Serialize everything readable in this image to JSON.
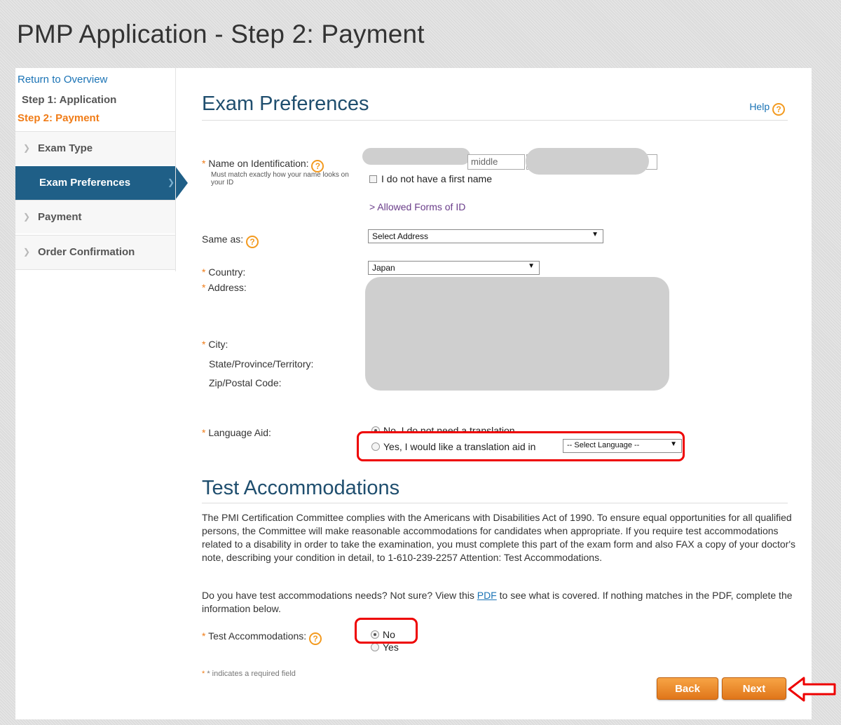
{
  "page": {
    "title": "PMP Application - Step 2: Payment"
  },
  "sidebar": {
    "return_link": "Return to Overview",
    "step1": "Step 1: Application",
    "step2": "Step 2: Payment",
    "items": [
      {
        "label": "Exam Type"
      },
      {
        "label": "Exam Preferences",
        "active": true
      },
      {
        "label": "Payment"
      },
      {
        "label": "Order Confirmation"
      }
    ]
  },
  "exam_preferences": {
    "title": "Exam Preferences",
    "help": "Help",
    "name_label": "Name on Identification:",
    "name_note": "Must match exactly how your name looks on your ID",
    "middle_placeholder": "middle",
    "no_first_name": "I do not have a first name",
    "allowed_forms": "> Allowed Forms of ID",
    "same_as_label": "Same as:",
    "same_as_value": "Select Address",
    "country_label": "Country:",
    "country_value": "Japan",
    "address_label": "Address:",
    "city_label": "City:",
    "state_label": "State/Province/Territory:",
    "zip_label": "Zip/Postal Code:",
    "language_label": "Language Aid:",
    "language_no": "No, I do not need a translation",
    "language_yes": "Yes, I would like a translation aid in",
    "language_select": "-- Select Language --"
  },
  "test_accommodations": {
    "title": "Test Accommodations",
    "para1": "The PMI Certification Committee complies with the Americans with Disabilities Act of 1990. To ensure equal opportunities for all qualified persons, the Committee will make reasonable accommodations for candidates when appropriate. If you require test accommodations related to a disability in order to take the examination, you must complete this part of the exam form and also FAX a copy of your doctor's note, describing your condition in detail, to 1-610-239-2257 Attention: Test Accommodations.",
    "para2_before": "Do you have test accommodations needs? Not sure? View this ",
    "pdf_link": "PDF",
    "para2_after": " to see what is covered. If nothing matches in the PDF, complete the information below.",
    "label": "Test Accommodations:",
    "option_no": "No",
    "option_yes": "Yes"
  },
  "footer": {
    "required_note": "* indicates a required field",
    "back": "Back",
    "next": "Next"
  },
  "colors": {
    "accent_orange": "#f07c17",
    "nav_active": "#1f5f87",
    "title_blue": "#1f4e6e",
    "highlight_red": "#e00000"
  }
}
